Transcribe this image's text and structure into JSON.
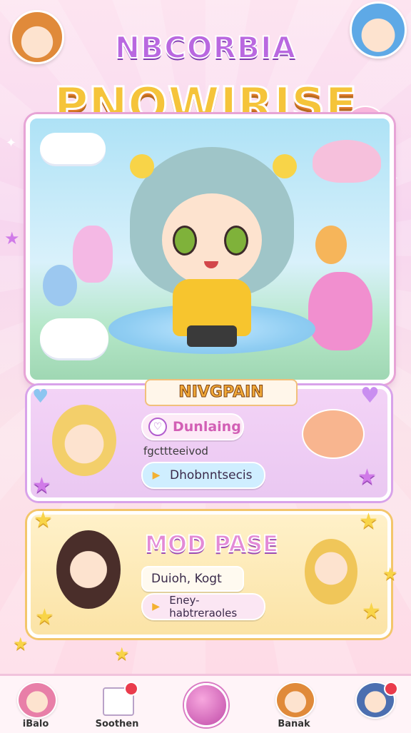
{
  "header": {
    "subtitle": "NBCORBIA",
    "title": "PNOWIRISE"
  },
  "panel_top": {
    "heading": "NIVGPAIN",
    "tag_label": "Dunlaing",
    "tag_icon": "heart-icon",
    "caption": "fgcttteeivod",
    "button_label": "Dhobnntsecis",
    "button_icon": "triangle-play-icon"
  },
  "panel_bottom": {
    "heading": "MOD PASE",
    "input_value": "Duioh, Kogt",
    "button_label": "Eney-habtreraoles",
    "button_icon": "triangle-play-icon"
  },
  "bottom_nav": {
    "items": [
      {
        "label": "iBalo",
        "icon": "avatar-girl-pink"
      },
      {
        "label": "Soothen",
        "icon": "document-icon"
      },
      {
        "label": "",
        "icon": "center-orb-icon"
      },
      {
        "label": "Banak",
        "icon": "avatar-girl-orange"
      },
      {
        "label": "",
        "icon": "avatar-girl-blue"
      }
    ]
  },
  "colors": {
    "accent_pink": "#e7a4d6",
    "accent_yellow": "#f3c66a",
    "title_yellow": "#f5c43a",
    "title_purple": "#b968e0"
  }
}
